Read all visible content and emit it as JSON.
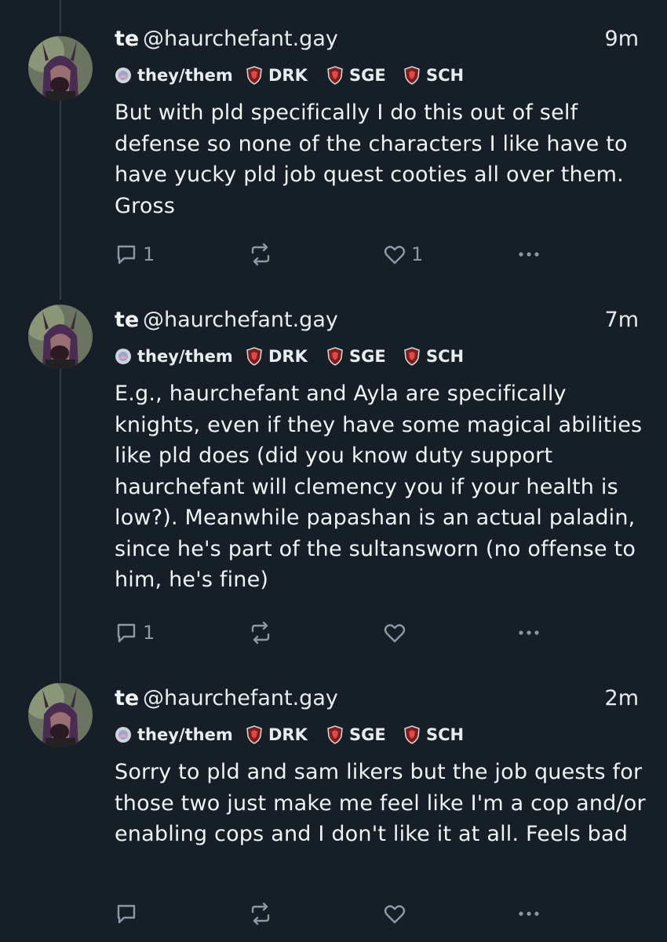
{
  "colors": {
    "background": "#161e27",
    "thread_line": "#2e3a48",
    "text": "#f1f3f5",
    "muted": "#8b98a5",
    "badge_red": "#c0392b"
  },
  "posts": [
    {
      "display_name": "te",
      "handle": "@haurchefant.gay",
      "time": "9m",
      "badges": {
        "pronouns": "they/them",
        "job1": "DRK",
        "job2": "SGE",
        "job3": "SCH"
      },
      "text": "But with pld specifically I do this out of self defense so none of the characters I like have to have yucky pld job quest cooties all over them. Gross",
      "reply_count": "1",
      "repost_count": "",
      "like_count": "1"
    },
    {
      "display_name": "te",
      "handle": "@haurchefant.gay",
      "time": "7m",
      "badges": {
        "pronouns": "they/them",
        "job1": "DRK",
        "job2": "SGE",
        "job3": "SCH"
      },
      "text": "E.g., haurchefant and Ayla are specifically knights, even if they have some magical abilities like pld does (did you know duty support haurchefant will clemency you if your health is low?). Meanwhile papashan is an actual paladin, since he's part of the sultansworn (no offense to him, he's fine)",
      "reply_count": "1",
      "repost_count": "",
      "like_count": ""
    },
    {
      "display_name": "te",
      "handle": "@haurchefant.gay",
      "time": "2m",
      "badges": {
        "pronouns": "they/them",
        "job1": "DRK",
        "job2": "SGE",
        "job3": "SCH"
      },
      "text": "Sorry to pld and sam likers but the job quests for those two just make me feel like I'm a cop and/or enabling cops and I don't like it at all. Feels bad",
      "reply_count": "",
      "repost_count": "",
      "like_count": ""
    }
  ],
  "icons": {
    "reply": "reply-icon",
    "repost": "repost-icon",
    "like": "heart-icon",
    "more": "more-icon",
    "pronoun_badge": "pronoun-badge-icon",
    "job_badge": "shield-badge-icon"
  }
}
